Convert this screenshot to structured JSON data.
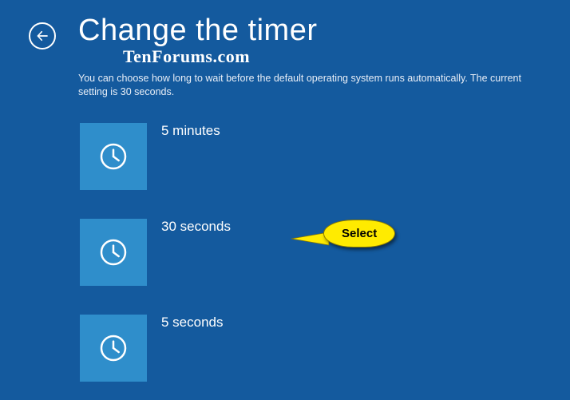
{
  "header": {
    "title": "Change the timer",
    "watermark": "TenForums.com",
    "description": "You can choose how long to wait before the default operating system runs automatically. The current setting is 30 seconds."
  },
  "options": [
    {
      "label": "5 minutes"
    },
    {
      "label": "30 seconds"
    },
    {
      "label": "5 seconds"
    }
  ],
  "callout": {
    "label": "Select"
  }
}
